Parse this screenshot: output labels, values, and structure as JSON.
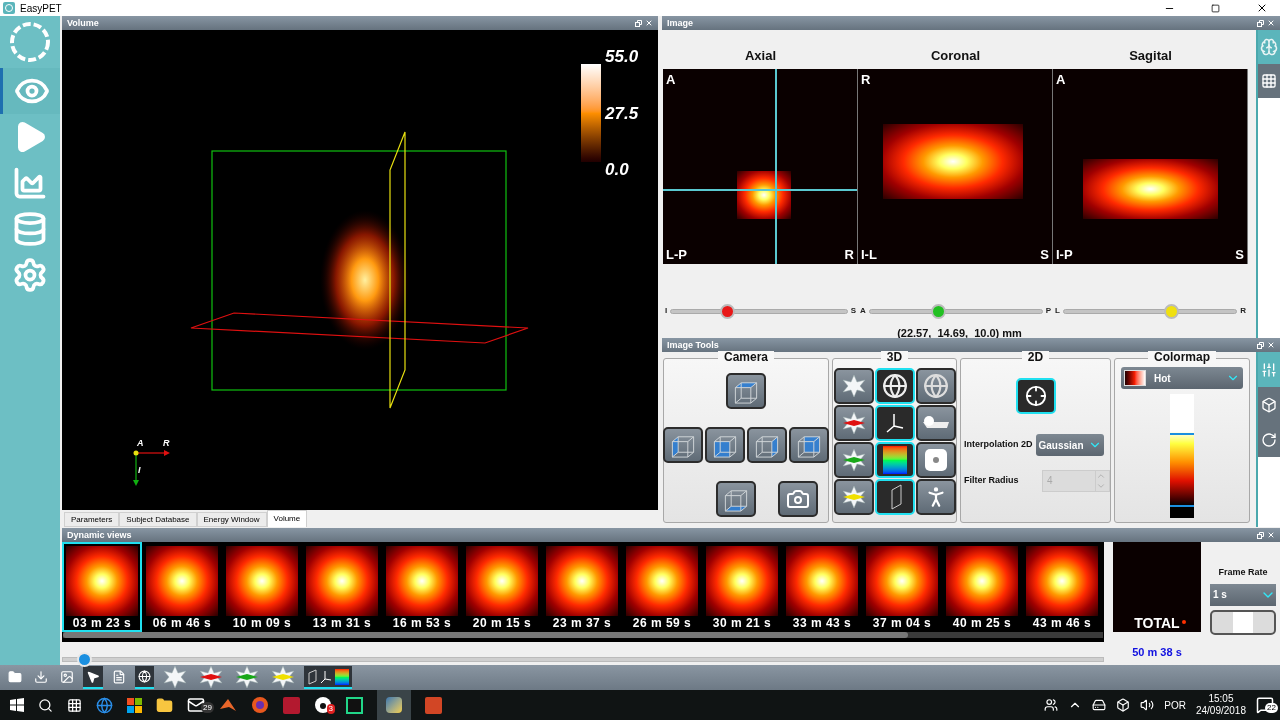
{
  "window": {
    "title": "EasyPET"
  },
  "sidebar": {
    "items": [
      {
        "selected": false
      },
      {
        "selected": true
      },
      {
        "selected": false
      },
      {
        "selected": false
      },
      {
        "selected": false
      },
      {
        "selected": false
      }
    ]
  },
  "volume": {
    "title": "Volume",
    "scale_labels": [
      "55.0",
      "27.5",
      "0.0"
    ],
    "axis_labels": [
      "A",
      "R",
      "I"
    ],
    "tabs": [
      {
        "label": "Parameters",
        "selected": false
      },
      {
        "label": "Subject Database",
        "selected": false
      },
      {
        "label": "Energy Window",
        "selected": false
      },
      {
        "label": "Volume",
        "selected": true
      }
    ]
  },
  "image": {
    "title": "Image",
    "views": [
      {
        "title": "Axial",
        "top_left": "A",
        "bottom_left": "L-P",
        "bottom_right": "R",
        "crosshair": true
      },
      {
        "title": "Coronal",
        "top_left": "R",
        "bottom_left": "I-L",
        "bottom_right": "S",
        "crosshair": false
      },
      {
        "title": "Sagital",
        "top_left": "A",
        "bottom_left": "I-P",
        "bottom_right": "S",
        "crosshair": false
      }
    ],
    "sliders": [
      {
        "start": "I",
        "end": "S",
        "level": 0.32,
        "color": "#e81818"
      },
      {
        "start": "A",
        "end": "P",
        "level": 0.4,
        "color": "#22c022"
      },
      {
        "start": "L",
        "end": "R",
        "level": 0.62,
        "color": "#f0e010"
      }
    ],
    "coordinates": "(22.57,  14.69,  10.0) mm",
    "side_tabs": [
      {
        "selected": true
      },
      {
        "selected": false
      }
    ]
  },
  "image_tools": {
    "title": "Image Tools",
    "camera_title": "Camera",
    "three_d": {
      "title": "3D",
      "buttons": [
        {
          "selected": false
        },
        {
          "selected": true
        },
        {
          "selected": false
        },
        {
          "selected": false
        },
        {
          "selected": true
        },
        {
          "selected": false
        },
        {
          "selected": false
        },
        {
          "selected": true
        },
        {
          "selected": false
        },
        {
          "selected": false
        },
        {
          "selected": true
        },
        {
          "selected": false
        }
      ]
    },
    "two_d": {
      "title": "2D",
      "crosshair_selected": true,
      "interpolation_label": "Interpolation 2D",
      "interpolation": "Gaussian",
      "filter_label": "Filter Radius",
      "filter_radius": "4",
      "filter_disabled": true
    },
    "colormap": {
      "title": "Colormap",
      "value": "Hot"
    },
    "side_tabs": [
      {
        "selected": true
      },
      {
        "selected": false
      },
      {
        "selected": false
      }
    ]
  },
  "dynamic_views": {
    "title": "Dynamic views",
    "frames": [
      {
        "time": "03 m 23 s",
        "selected": true
      },
      {
        "time": "06 m 46 s",
        "selected": false
      },
      {
        "time": "10 m 09 s",
        "selected": false
      },
      {
        "time": "13 m 31 s",
        "selected": false
      },
      {
        "time": "16 m 53 s",
        "selected": false
      },
      {
        "time": "20 m 15 s",
        "selected": false
      },
      {
        "time": "23 m 37 s",
        "selected": false
      },
      {
        "time": "26 m 59 s",
        "selected": false
      },
      {
        "time": "30 m 21 s",
        "selected": false
      },
      {
        "time": "33 m 43 s",
        "selected": false
      },
      {
        "time": "37 m 04 s",
        "selected": false
      },
      {
        "time": "40 m 25 s",
        "selected": false
      },
      {
        "time": "43 m 46 s",
        "selected": false
      }
    ],
    "total_label": "TOTAL",
    "total_time": "50 m 38 s",
    "frame_rate_label": "Frame Rate",
    "frame_rate": "1 s",
    "timeline": {
      "level": 0.015
    }
  },
  "toolbar": {
    "items": [
      {
        "selected": false
      },
      {
        "selected": false
      },
      {
        "selected": false
      },
      {
        "selected": true
      },
      {
        "selected": false
      },
      {
        "selected": true
      },
      {
        "selected": false
      },
      {
        "selected": false
      },
      {
        "selected": false
      },
      {
        "selected": false
      },
      {
        "selected": true
      }
    ]
  },
  "taskbar": {
    "mail_badge": "29",
    "app_badge": "3",
    "language": "POR",
    "time": "15:05",
    "date": "24/09/2018",
    "notification_count": "22"
  }
}
